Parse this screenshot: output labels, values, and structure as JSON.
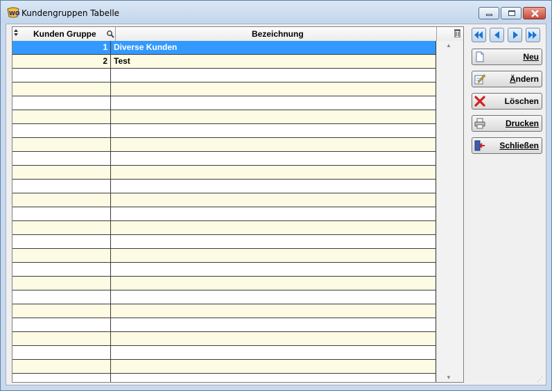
{
  "window": {
    "title": "Kundengruppen Tabelle"
  },
  "grid": {
    "columns": [
      {
        "label": "Kunden Gruppe"
      },
      {
        "label": "Bezeichnung"
      }
    ],
    "rows": [
      {
        "group": "1",
        "name": "Diverse Kunden",
        "selected": true
      },
      {
        "group": "2",
        "name": "Test",
        "selected": false
      }
    ]
  },
  "actions": {
    "neu": "Neu",
    "aendern": "Ändern",
    "loeschen": "Löschen",
    "drucken": "Drucken",
    "schliessen": "Schließen"
  },
  "colors": {
    "selection": "#3399ff",
    "row_alt": "#fdfbe3",
    "delete_icon": "#d42020"
  }
}
